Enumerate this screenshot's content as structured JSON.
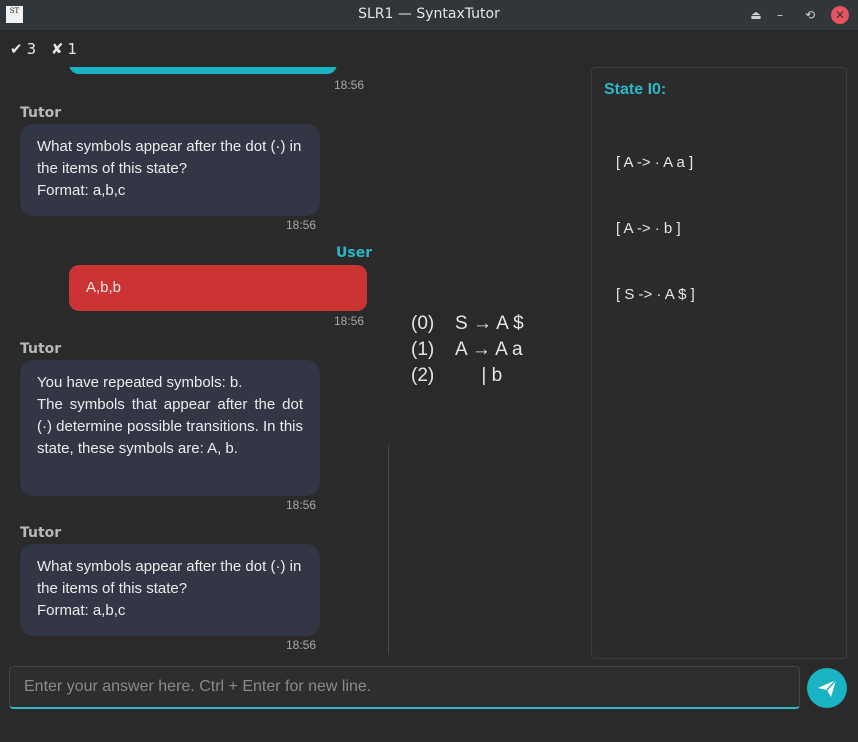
{
  "window": {
    "title": "SLR1 — SyntaxTutor",
    "app_icon_text": "ST",
    "controls": [
      "keep-above-icon",
      "minimize-icon",
      "restore-icon",
      "close-icon"
    ]
  },
  "score": {
    "correct_icon": "✔",
    "correct": "3",
    "wrong_icon": "✘",
    "wrong": "1"
  },
  "chat": {
    "messages": [
      {
        "sender": "",
        "text": "",
        "time": "18:56"
      },
      {
        "sender": "Tutor",
        "text": "What symbols appear after the dot (·) in the items of this state?\nFormat: a,b,c",
        "time": "18:56"
      },
      {
        "sender": "User",
        "text": "A,b,b",
        "time": "18:56"
      },
      {
        "sender": "Tutor",
        "text": "You have repeated symbols: b.\nThe symbols that appear after the dot (·) determine possible transitions. In this state, these symbols are: A, b.",
        "time": "18:56"
      },
      {
        "sender": "Tutor",
        "text": "What symbols appear after the dot (·) in the items of this state?\nFormat: a,b,c",
        "time": "18:56"
      }
    ]
  },
  "grammar": [
    {
      "num": "(0)",
      "rule": "S → A $"
    },
    {
      "num": "(1)",
      "rule": "A → A a"
    },
    {
      "num": "(2)",
      "rule": "     | b"
    }
  ],
  "state": {
    "title": "State I0:",
    "items": [
      "[ A -> · A a ]",
      "[ A -> · b ]",
      "[ S -> · A $ ]"
    ]
  },
  "input": {
    "value": "",
    "placeholder": "Enter your answer here. Ctrl + Enter for new line."
  },
  "send_icon": "send-icon",
  "colors": {
    "accent": "#1ab3c4",
    "user_bubble": "#cc3333",
    "tutor_bubble": "#333745",
    "background": "#2a2a2a"
  }
}
